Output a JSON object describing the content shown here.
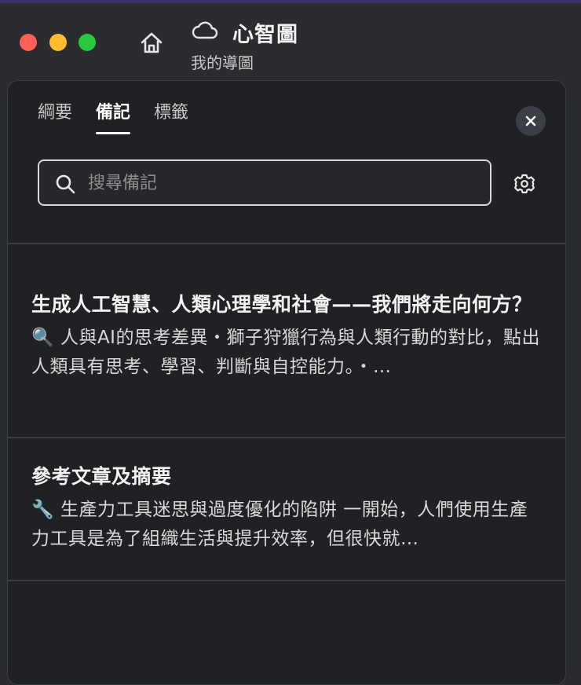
{
  "window": {
    "title": "心智圖",
    "subtitle": "我的導圖"
  },
  "tabs": [
    {
      "label": "綱要",
      "active": false
    },
    {
      "label": "備記",
      "active": true
    },
    {
      "label": "標籤",
      "active": false
    }
  ],
  "search": {
    "placeholder": "搜尋備記",
    "value": ""
  },
  "notes": [
    {
      "title": "生成人工智慧、人類心理學和社會——我們將走向何方？",
      "body": "🔍 人與AI的思考差異・獅子狩獵行為與人類行動的對比，點出人類具有思考、學習、判斷與自控能力。・…"
    },
    {
      "title": "參考文章及摘要",
      "body": "🔧 生產力工具迷思與過度優化的陷阱 一開始，人們使用生產力工具是為了組織生活與提升效率，但很快就…"
    }
  ],
  "colors": {
    "traffic_red": "#ff5f57",
    "traffic_yellow": "#febc2e",
    "traffic_green": "#28c840",
    "panel_bg": "#1f2124"
  }
}
